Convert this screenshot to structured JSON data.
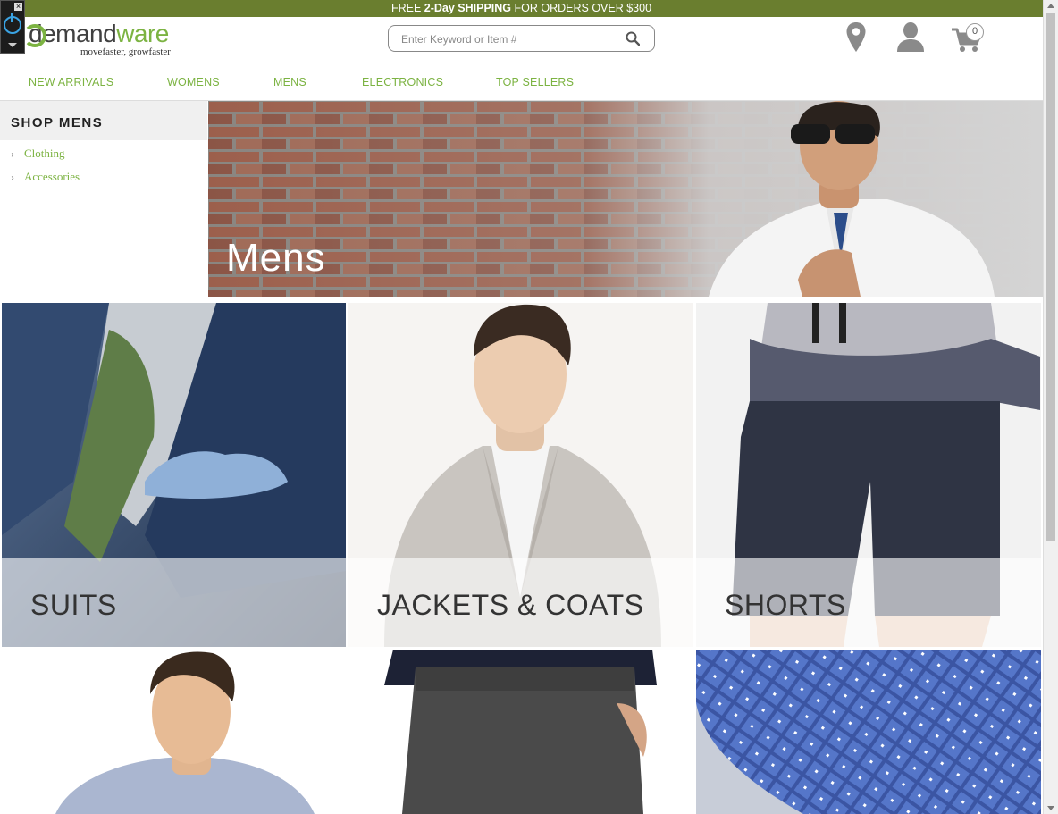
{
  "promo": {
    "part1": "FREE ",
    "bold1": "2-Day",
    "part2": " ",
    "bold2": "SHIPPING",
    "part3": " FOR ORDERS OVER $300"
  },
  "logo": {
    "name_dark": "demand",
    "name_green": "ware",
    "tagline": "movefaster, growfaster"
  },
  "search": {
    "placeholder": "Enter Keyword or Item #"
  },
  "header": {
    "cart_count": "0"
  },
  "nav": {
    "items": [
      "NEW ARRIVALS",
      "WOMENS",
      "MENS",
      "ELECTRONICS",
      "TOP SELLERS"
    ]
  },
  "sidebar": {
    "title": "SHOP MENS",
    "items": [
      "Clothing",
      "Accessories"
    ]
  },
  "hero": {
    "title": "Mens"
  },
  "tiles": [
    "SUITS",
    "JACKETS & COATS",
    "SHORTS"
  ],
  "colors": {
    "brand_green": "#7cb342",
    "promo_bar": "#6a7e2f"
  }
}
